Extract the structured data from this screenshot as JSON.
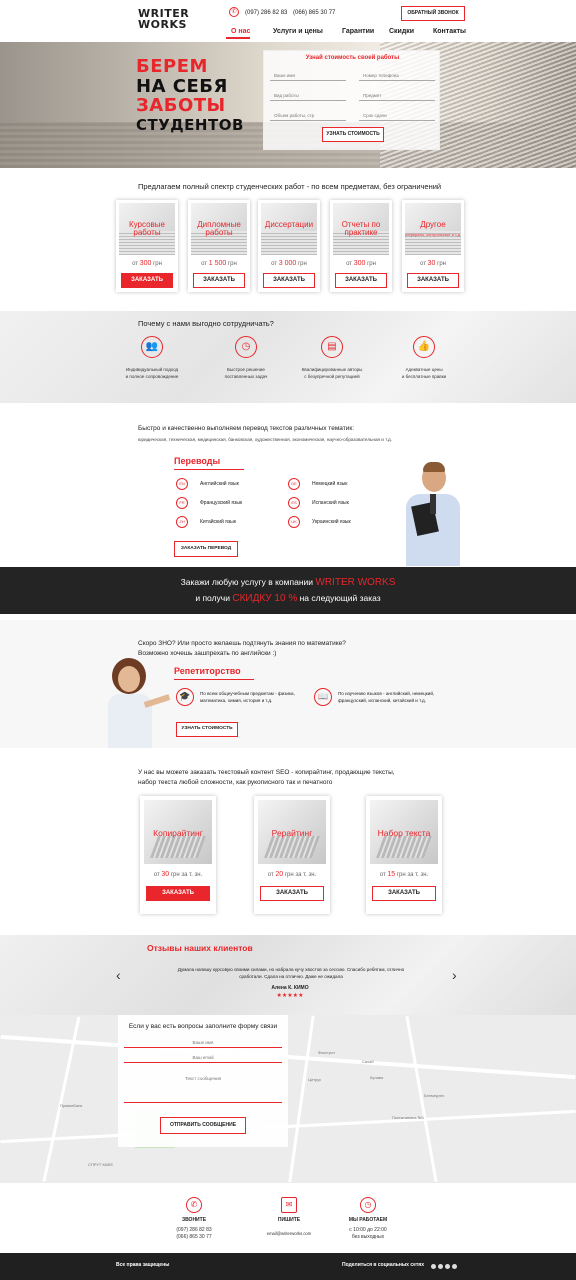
{
  "header": {
    "logo_line1": "WRITER",
    "logo_line2": "WORKS",
    "phone1": "(097) 286 82 83",
    "phone2": "(066) 865 30 77",
    "callback_label": "ОБРАТНЫЙ ЗВОНОК",
    "nav": [
      "О нас",
      "Услуги и цены",
      "Гарантии",
      "Скидки",
      "Контакты"
    ]
  },
  "hero": {
    "title_lines": [
      "БЕРЕМ",
      "НА СЕБЯ",
      "ЗАБОТЫ",
      "СТУДЕНТОВ"
    ],
    "form_title": "Узнай стоимость своей работы",
    "fields": [
      "Ваше имя",
      "Номер телефона",
      "Вид работы",
      "Предмет",
      "Объем работы, стр",
      "Срок сдачи"
    ],
    "button": "УЗНАТЬ СТОИМОСТЬ"
  },
  "services": {
    "intro": "Предлагаем полный спектр студенческих работ - по всем предметам, без ограничений",
    "cards": [
      {
        "title": "Курсовые работы",
        "subtitle": "",
        "price_prefix": "от",
        "price_value": "300",
        "price_unit": "грн",
        "button": "ЗАКАЗАТЬ",
        "active": true
      },
      {
        "title": "Дипломные работы",
        "subtitle": "",
        "price_prefix": "от",
        "price_value": "1 500",
        "price_unit": "грн",
        "button": "ЗАКАЗАТЬ",
        "active": false
      },
      {
        "title": "Диссертации",
        "subtitle": "",
        "price_prefix": "от",
        "price_value": "3 000",
        "price_unit": "грн",
        "button": "ЗАКАЗАТЬ",
        "active": false
      },
      {
        "title": "Отчеты по практике",
        "subtitle": "",
        "price_prefix": "от",
        "price_value": "300",
        "price_unit": "грн",
        "button": "ЗАКАЗАТЬ",
        "active": false
      },
      {
        "title": "Другое",
        "subtitle": "рефераты, контрольные и т.д.",
        "price_prefix": "от",
        "price_value": "30",
        "price_unit": "грн",
        "button": "ЗАКАЗАТЬ",
        "active": false
      }
    ]
  },
  "why": {
    "title": "Почему с нами выгодно сотрудничать?",
    "items": [
      {
        "icon": "people-icon",
        "line1": "Индивидуальный подход",
        "line2": "и полное сопровождение"
      },
      {
        "icon": "clock-icon",
        "line1": "Быстрое решение",
        "line2": "поставленных задач"
      },
      {
        "icon": "document-icon",
        "line1": "Квалифицированные авторы",
        "line2": "с безупречной репутацией"
      },
      {
        "icon": "thumbs-up-icon",
        "line1": "Адекватные цены",
        "line2": "и бесплатные правки"
      }
    ]
  },
  "translation": {
    "title": "Быстро и качественно выполняем перевод текстов различных тематик:",
    "topics": "юридическая, техническая, медицинская, банковская, художественная, экономическая, научно-образовательная и т.д.",
    "heading": "Переводы",
    "languages": [
      {
        "code": "EN",
        "name": "Английский язык"
      },
      {
        "code": "FR",
        "name": "Французский язык"
      },
      {
        "code": "ZH",
        "name": "Китайский язык"
      },
      {
        "code": "DE",
        "name": "Немецкий язык"
      },
      {
        "code": "ES",
        "name": "Испанский язык"
      },
      {
        "code": "UK",
        "name": "Украинский язык"
      }
    ],
    "button": "ЗАКАЗАТЬ ПЕРЕВОД"
  },
  "promo": {
    "line1_a": "Закажи любую услугу в компании",
    "line1_b": "WRITER WORKS",
    "line2_a": "и получи",
    "line2_b": "СКИДКУ 10 %",
    "line2_c": "на следующий заказ"
  },
  "tutoring": {
    "question1": "Скоро ЗНО? Или просто желаешь подтянуть знания по математике?",
    "question2": "Возможно хочешь зашпрехать по английски :)",
    "heading": "Репетиторство",
    "item1": "По всем общеучебным предметам - физика, математика, химия, история и т.д.",
    "item2": "По изучению языков - английский, немецкий, французский, испанский, китайский и т.д.",
    "button": "УЗНАТЬ СТОИМОСТЬ"
  },
  "content": {
    "intro1": "У нас вы можете заказать текстовый контент SEO - копирайтинг, продающие тексты,",
    "intro2": "набор текста любой сложности, как рукописного так и печатного",
    "cards": [
      {
        "title": "Копирайтинг",
        "price_prefix": "от",
        "price_value": "30",
        "price_unit": "грн за т. зн.",
        "button": "ЗАКАЗАТЬ",
        "active": true
      },
      {
        "title": "Рерайтинг",
        "price_prefix": "от",
        "price_value": "20",
        "price_unit": "грн за т. зн.",
        "button": "ЗАКАЗАТЬ",
        "active": false
      },
      {
        "title": "Набор текста",
        "price_prefix": "от",
        "price_value": "15",
        "price_unit": "грн за т. зн.",
        "button": "ЗАКАЗАТЬ",
        "active": false
      }
    ]
  },
  "reviews": {
    "title": "Отзывы наших клиентов",
    "text1": "Думала напишу курсовую своими силами, но набрала кучу хвостов за сессию. Спасибо ребятам, отлично",
    "text2": "сработали. Сдала на отлично. Даже не ожидала",
    "author": "Алена К. КИМО",
    "stars": "★★★★★",
    "prev": "‹",
    "next": "›"
  },
  "map": {
    "labels": [
      "Фокстрот",
      "Сахаб",
      "Цитрус",
      "Кулава",
      "ПриватБанк",
      "СПРУТ КАФЕ",
      "Белмедтех",
      "Поликлиника №1"
    ],
    "form_title": "Если у вас есть вопросы заполните форму связи",
    "fields": [
      "Ваше имя",
      "Ваш email",
      "Текст сообщения"
    ],
    "button": "ОТПРАВИТЬ СООБЩЕНИЕ"
  },
  "contacts": {
    "call_title": "ЗВОНИТЕ",
    "call_phone1": "(097) 286 82 83",
    "call_phone2": "(066) 865 30 77",
    "write_title": "ПИШИТЕ",
    "write_email": "email@writerworks.com",
    "hours_title": "МЫ РАБОТАЕМ",
    "hours_line1": "с 10:00 до 22:00",
    "hours_line2": "без выходных"
  },
  "footer": {
    "rights": "Все права защищены",
    "share": "Поделиться в социальных сетях"
  },
  "colors": {
    "accent": "#e8262b",
    "dark": "#242424"
  }
}
